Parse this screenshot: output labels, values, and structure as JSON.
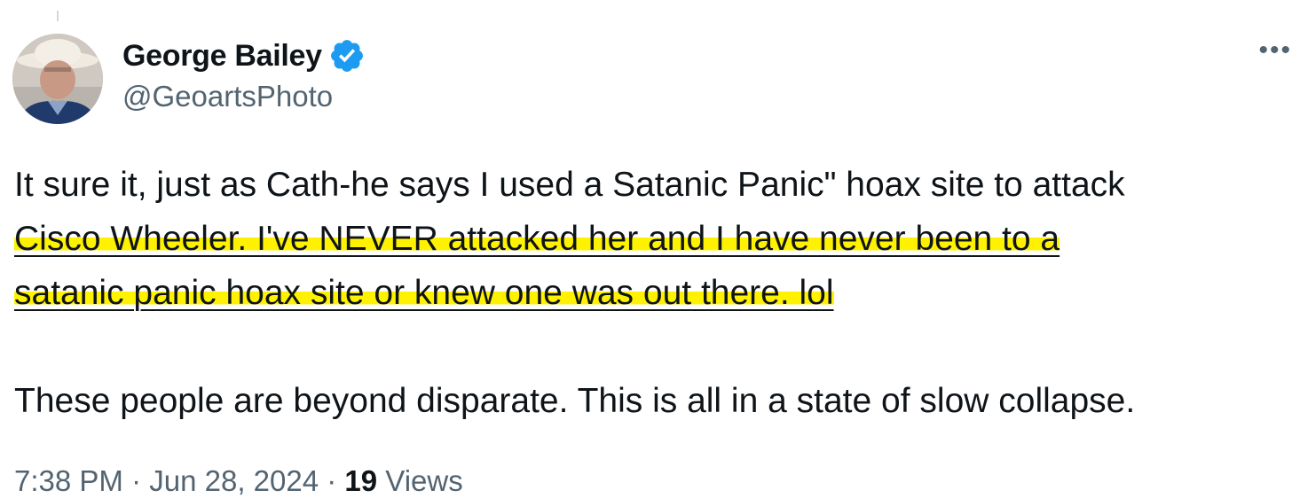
{
  "author": {
    "name": "George Bailey",
    "handle": "@GeoartsPhoto",
    "verified_color": "#1d9bf0"
  },
  "tweet": {
    "line1": "It sure it, just as Cath-he says I used a Satanic Panic\" hoax site to attack",
    "line2": "Cisco Wheeler.  I've NEVER attacked her and I have never been to a",
    "line3": "satanic panic hoax site or knew one was out there. lol",
    "line4": "These people are beyond disparate.  This is all in a state of slow collapse."
  },
  "meta": {
    "time": "7:38 PM",
    "sep1": " · ",
    "date": "Jun 28, 2024",
    "sep2": " · ",
    "views_count": "19",
    "views_label": " Views"
  },
  "icons": {
    "more": "more-options-icon",
    "verified": "verified-badge-icon"
  },
  "highlight_color": "#fff200"
}
